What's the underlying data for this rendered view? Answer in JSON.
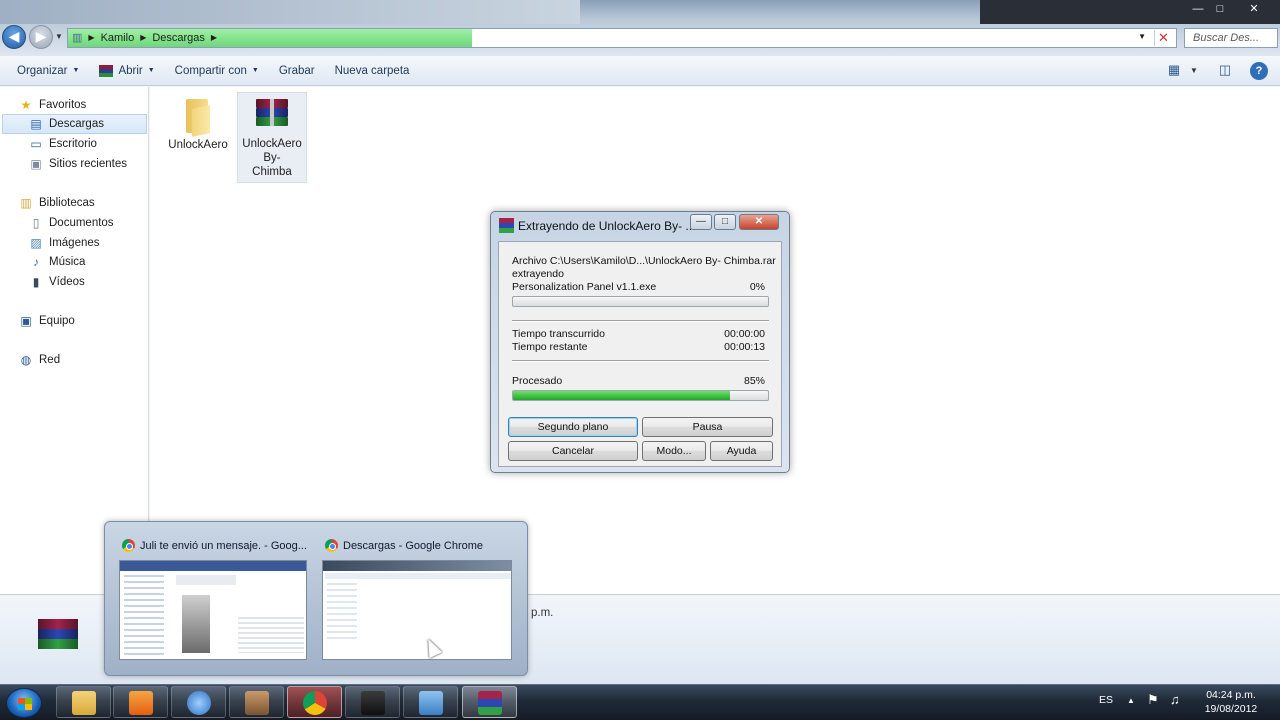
{
  "explorer": {
    "breadcrumbs": [
      "Kamilo",
      "Descargas"
    ],
    "search_placeholder": "Buscar Des...",
    "toolbar": {
      "organize": "Organizar",
      "open": "Abrir",
      "share": "Compartir con",
      "burn": "Grabar",
      "new_folder": "Nueva carpeta"
    },
    "nav": {
      "favorites": "Favoritos",
      "downloads": "Descargas",
      "desktop": "Escritorio",
      "recent": "Sitios recientes",
      "libraries": "Bibliotecas",
      "documents": "Documentos",
      "images": "Imágenes",
      "music": "Música",
      "videos": "Vídeos",
      "computer": "Equipo",
      "network": "Red"
    },
    "files": [
      {
        "name": "UnlockAero",
        "icon": "folder-icon"
      },
      {
        "name": "UnlockAero By-Chimba",
        "name_lines": [
          "UnlockAero",
          "By-",
          "Chimba"
        ],
        "icon": "winrar-icon"
      }
    ],
    "details_text": "p.m."
  },
  "dialog": {
    "title": "Extrayendo de UnlockAero By- ...",
    "archive_line": "Archivo C:\\Users\\Kamilo\\D...\\UnlockAero By- Chimba.rar",
    "status": "extrayendo",
    "current_file": "Personalization Panel v1.1.exe",
    "file_progress_label": "0%",
    "file_progress": 0.0,
    "elapsed_label": "Tiempo transcurrido",
    "elapsed": "00:00:00",
    "remaining_label": "Tiempo restante",
    "remaining": "00:00:13",
    "processed_label": "Procesado",
    "processed_pct_label": "85%",
    "processed": 0.85,
    "buttons": {
      "background": "Segundo plano",
      "pause": "Pausa",
      "cancel": "Cancelar",
      "mode": "Modo...",
      "help": "Ayuda"
    }
  },
  "thumbnails": [
    {
      "title": "Juli te envió un mensaje. - Goog..."
    },
    {
      "title": "Descargas - Google Chrome"
    }
  ],
  "taskbar": {
    "language": "ES",
    "time": "04:24 p.m.",
    "date": "19/08/2012",
    "apps": [
      "explorer-icon",
      "media-player-icon",
      "globe-icon",
      "avatar-icon",
      "chrome-icon",
      "camera-icon",
      "control-panel-icon",
      "winrar-icon"
    ]
  },
  "colors": {
    "progress_green": "#1fa626",
    "address_progress": "#6ed77a",
    "taskbar": "#1f2a38"
  }
}
